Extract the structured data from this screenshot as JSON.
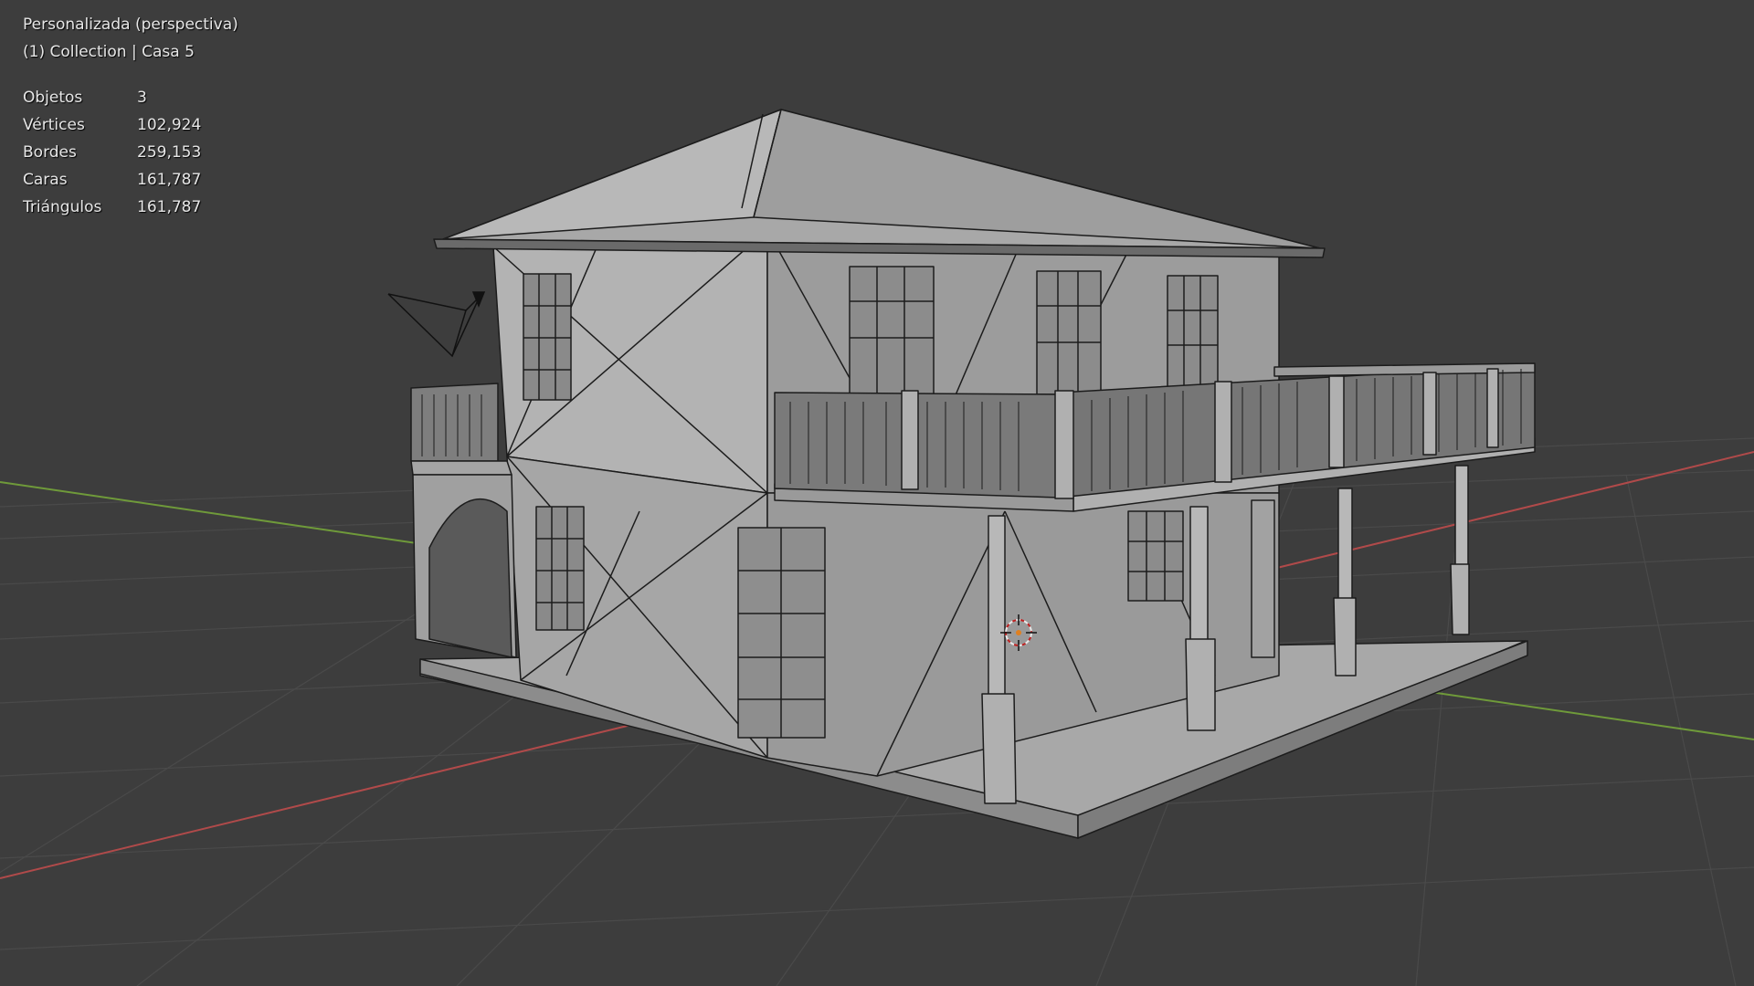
{
  "viewport": {
    "view_name": "Personalizada (perspectiva)",
    "collection_info": "(1) Collection | Casa 5"
  },
  "stats": [
    {
      "label": "Objetos",
      "value": "3"
    },
    {
      "label": "Vértices",
      "value": "102,924"
    },
    {
      "label": "Bordes",
      "value": "259,153"
    },
    {
      "label": "Caras",
      "value": "161,787"
    },
    {
      "label": "Triángulos",
      "value": "161,787"
    }
  ],
  "colors": {
    "background": "#3d3d3d",
    "grid_line": "#4a4a4a",
    "x_axis": "#b04a4a",
    "y_axis": "#6f9a3a",
    "mesh_light": "#b8b8b8",
    "mesh_mid": "#9e9e9e",
    "mesh_dark": "#7a7a7a",
    "wire": "#1c1c1c"
  },
  "icons": {
    "camera": "camera-object-icon",
    "cursor": "3d-cursor-icon"
  }
}
